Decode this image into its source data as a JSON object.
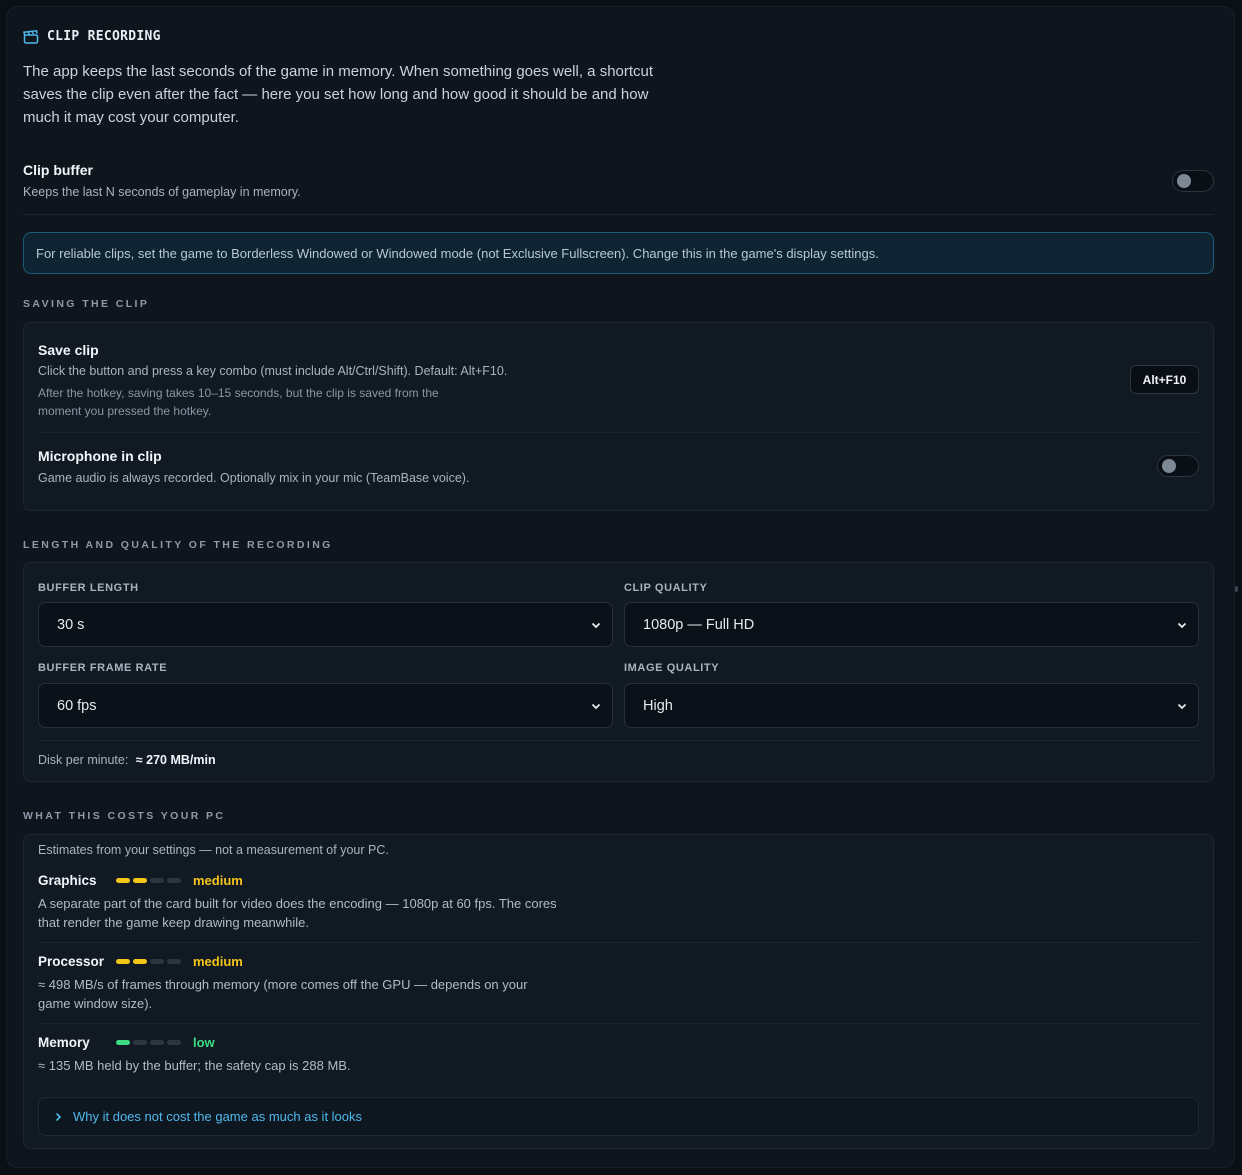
{
  "section": {
    "title": "CLIP RECORDING",
    "icon": "clapperboard-icon",
    "intro": "The app keeps the last seconds of the game in memory. When something goes well, a shortcut saves the clip even after the fact — here you set how long and how good it should be and how much it may cost your computer."
  },
  "clip_buffer": {
    "title": "Clip buffer",
    "desc": "Keeps the last N seconds of gameplay in memory.",
    "enabled": false
  },
  "notice": "For reliable clips, set the game to Borderless Windowed or Windowed mode (not Exclusive Fullscreen). Change this in the game's display settings.",
  "saving": {
    "heading": "SAVING THE CLIP",
    "save_clip": {
      "title": "Save clip",
      "desc": "Click the button and press a key combo (must include Alt/Ctrl/Shift). Default: Alt+F10.",
      "note": "After the hotkey, saving takes 10–15 seconds, but the clip is saved from the moment you pressed the hotkey.",
      "hotkey": "Alt+F10"
    },
    "microphone": {
      "title": "Microphone in clip",
      "desc": "Game audio is always recorded. Optionally mix in your mic (TeamBase voice).",
      "enabled": false
    }
  },
  "quality": {
    "heading": "LENGTH AND QUALITY OF THE RECORDING",
    "buffer_length": {
      "label": "BUFFER LENGTH",
      "value": "30 s"
    },
    "clip_quality": {
      "label": "CLIP QUALITY",
      "value": "1080p — Full HD"
    },
    "frame_rate": {
      "label": "BUFFER FRAME RATE",
      "value": "60 fps"
    },
    "image_quality": {
      "label": "IMAGE QUALITY",
      "value": "High"
    },
    "disk_label": "Disk per minute:",
    "disk_value": "≈ 270 MB/min"
  },
  "costs": {
    "heading": "WHAT THIS COSTS YOUR PC",
    "note": "Estimates from your settings — not a measurement of your PC.",
    "graphics": {
      "title": "Graphics",
      "level": "medium",
      "filled": 2,
      "of": 4,
      "text": "A separate part of the card built for video does the encoding — 1080p at 60 fps. The cores that render the game keep drawing meanwhile."
    },
    "processor": {
      "title": "Processor",
      "level": "medium",
      "filled": 2,
      "of": 4,
      "text": "≈ 498 MB/s of frames through memory (more comes off the GPU — depends on your game window size)."
    },
    "memory": {
      "title": "Memory",
      "level": "low",
      "filled": 1,
      "of": 4,
      "text": "≈ 135 MB held by the buffer; the safety cap is 288 MB."
    },
    "expander": "Why it does not cost the game as much as it looks"
  },
  "colors": {
    "accent": "#4fb8ec",
    "medium": "#f5c518",
    "low": "#3ddc84"
  }
}
